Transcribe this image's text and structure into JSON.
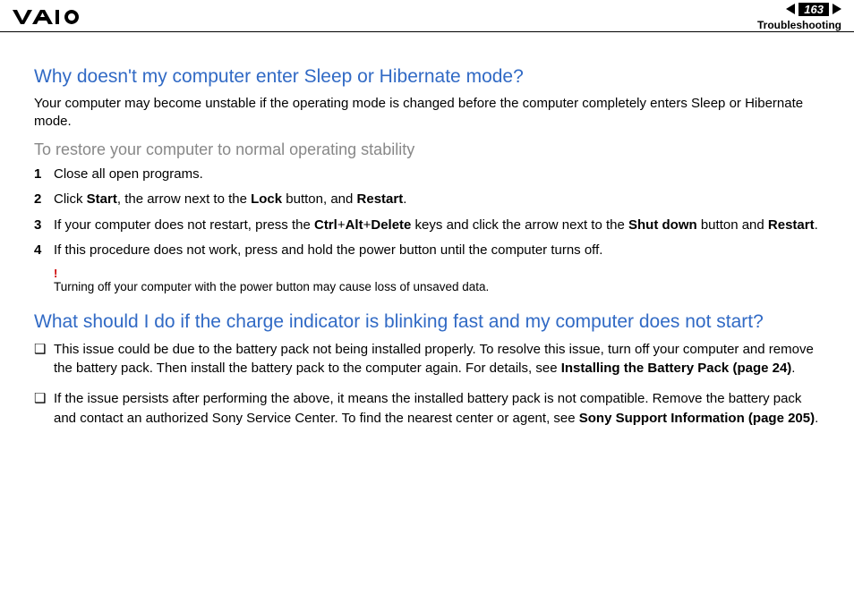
{
  "header": {
    "page_number": "163",
    "section": "Troubleshooting"
  },
  "q1": {
    "title": "Why doesn't my computer enter Sleep or Hibernate mode?",
    "lead": "Your computer may become unstable if the operating mode is changed before the computer completely enters Sleep or Hibernate mode.",
    "sub": "To restore your computer to normal operating stability",
    "steps": {
      "s1": "Close all open programs.",
      "s2_a": "Click ",
      "s2_b_start": "Start",
      "s2_c": ", the arrow next to the ",
      "s2_b_lock": "Lock",
      "s2_d": " button, and ",
      "s2_b_restart": "Restart",
      "s2_e": ".",
      "s3_a": "If your computer does not restart, press the ",
      "s3_b_ctrl": "Ctrl",
      "s3_plus1": "+",
      "s3_b_alt": "Alt",
      "s3_plus2": "+",
      "s3_b_del": "Delete",
      "s3_c": " keys and click the arrow next to the ",
      "s3_b_sd": "Shut down",
      "s3_d": " button and ",
      "s3_b_restart": "Restart",
      "s3_e": ".",
      "s4": "If this procedure does not work, press and hold the power button until the computer turns off."
    },
    "note_bang": "!",
    "note": "Turning off your computer with the power button may cause loss of unsaved data."
  },
  "q2": {
    "title": "What should I do if the charge indicator is blinking fast and my computer does not start?",
    "b1_a": "This issue could be due to the battery pack not being installed properly. To resolve this issue, turn off your computer and remove the battery pack. Then install the battery pack to the computer again. For details, see ",
    "b1_link": "Installing the Battery Pack (page 24)",
    "b1_b": ".",
    "b2_a": "If the issue persists after performing the above, it means the installed battery pack is not compatible. Remove the battery pack and contact an authorized Sony Service Center. To find the nearest center or agent, see ",
    "b2_link": "Sony Support Information (page 205)",
    "b2_b": "."
  }
}
